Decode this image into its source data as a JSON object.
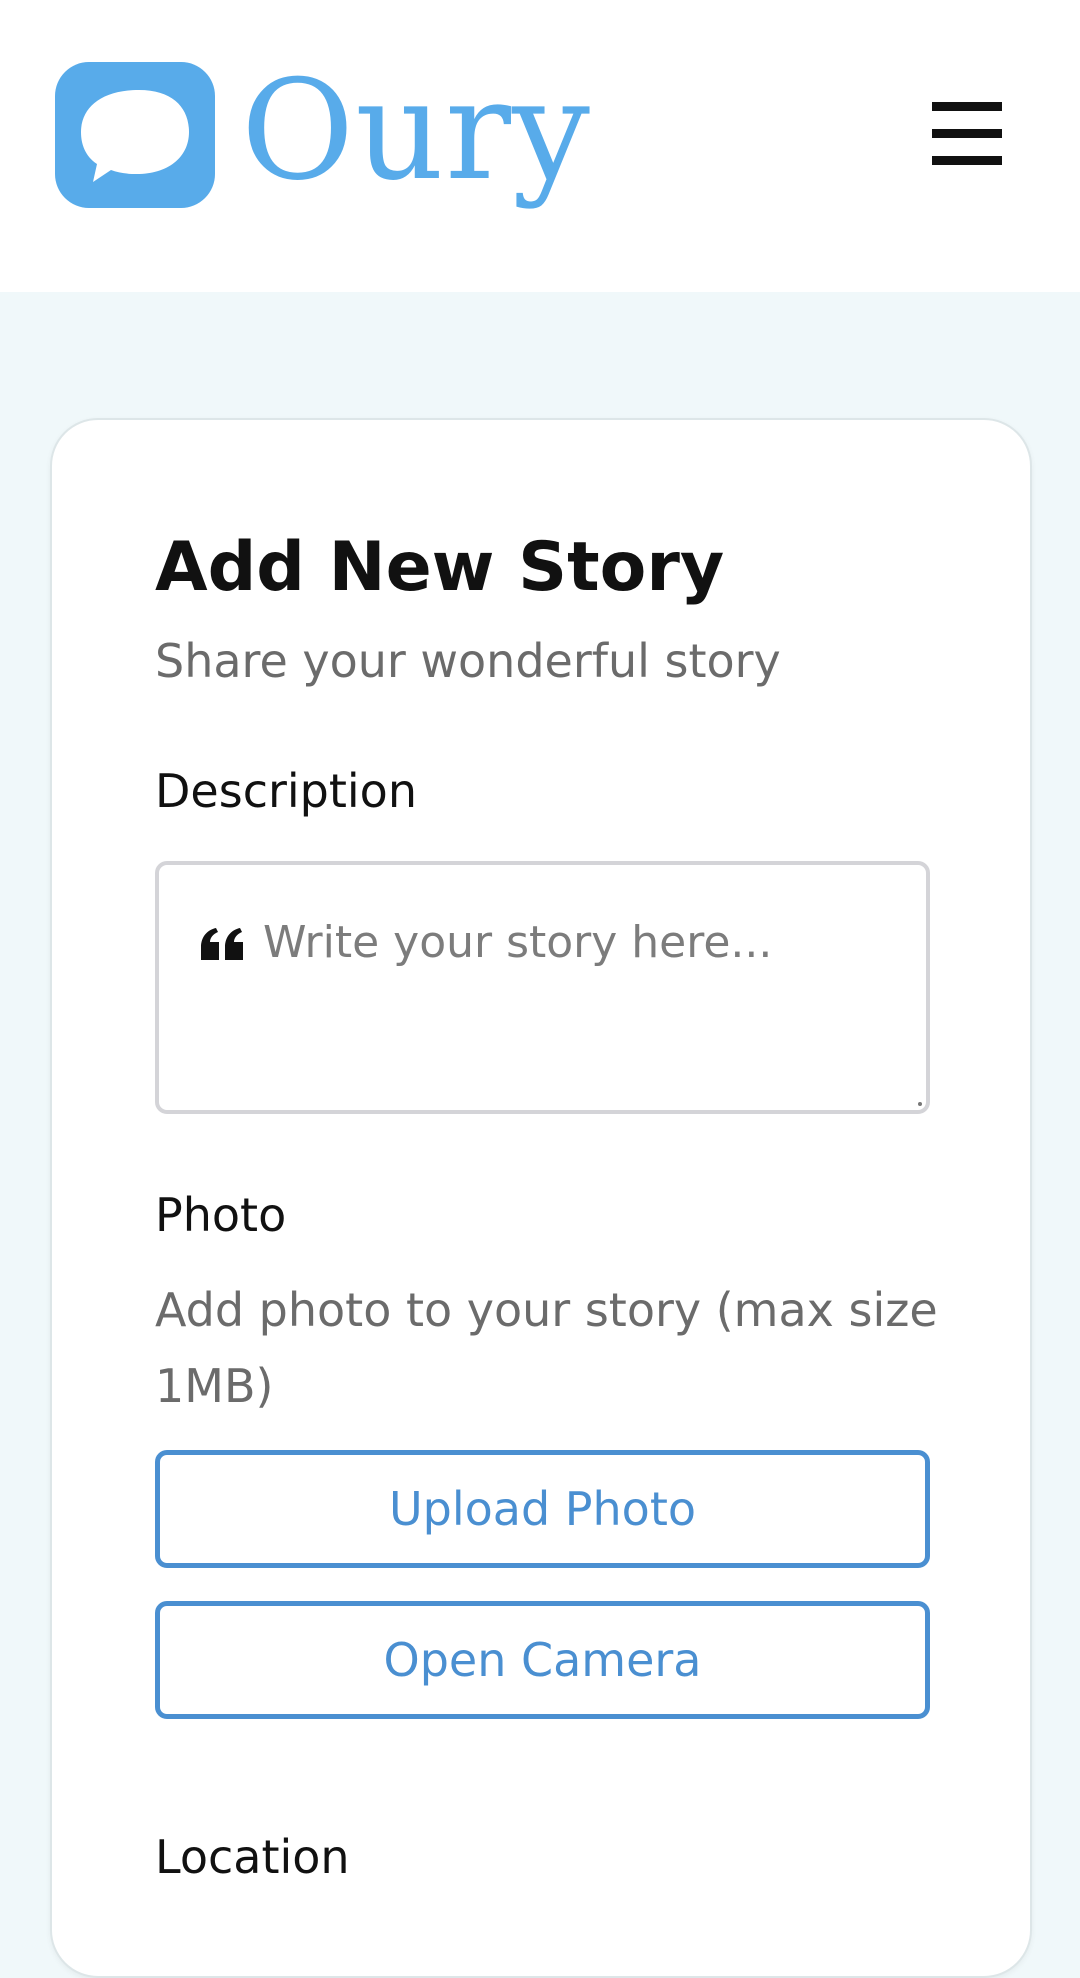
{
  "header": {
    "brand_name": "Oury",
    "logo_icon": "chat-bubble-icon",
    "menu_icon": "hamburger-icon",
    "brand_color": "#58abea"
  },
  "form": {
    "title": "Add New Story",
    "subtitle": "Share your wonderful story",
    "description": {
      "label": "Description",
      "placeholder": "Write your story here...",
      "value": "",
      "icon": "quote-icon"
    },
    "photo": {
      "label": "Photo",
      "help_text": "Add photo to your story (max size 1MB)",
      "upload_label": "Upload Photo",
      "camera_label": "Open Camera",
      "button_color": "#4a8fd1"
    },
    "location": {
      "label": "Location"
    }
  }
}
